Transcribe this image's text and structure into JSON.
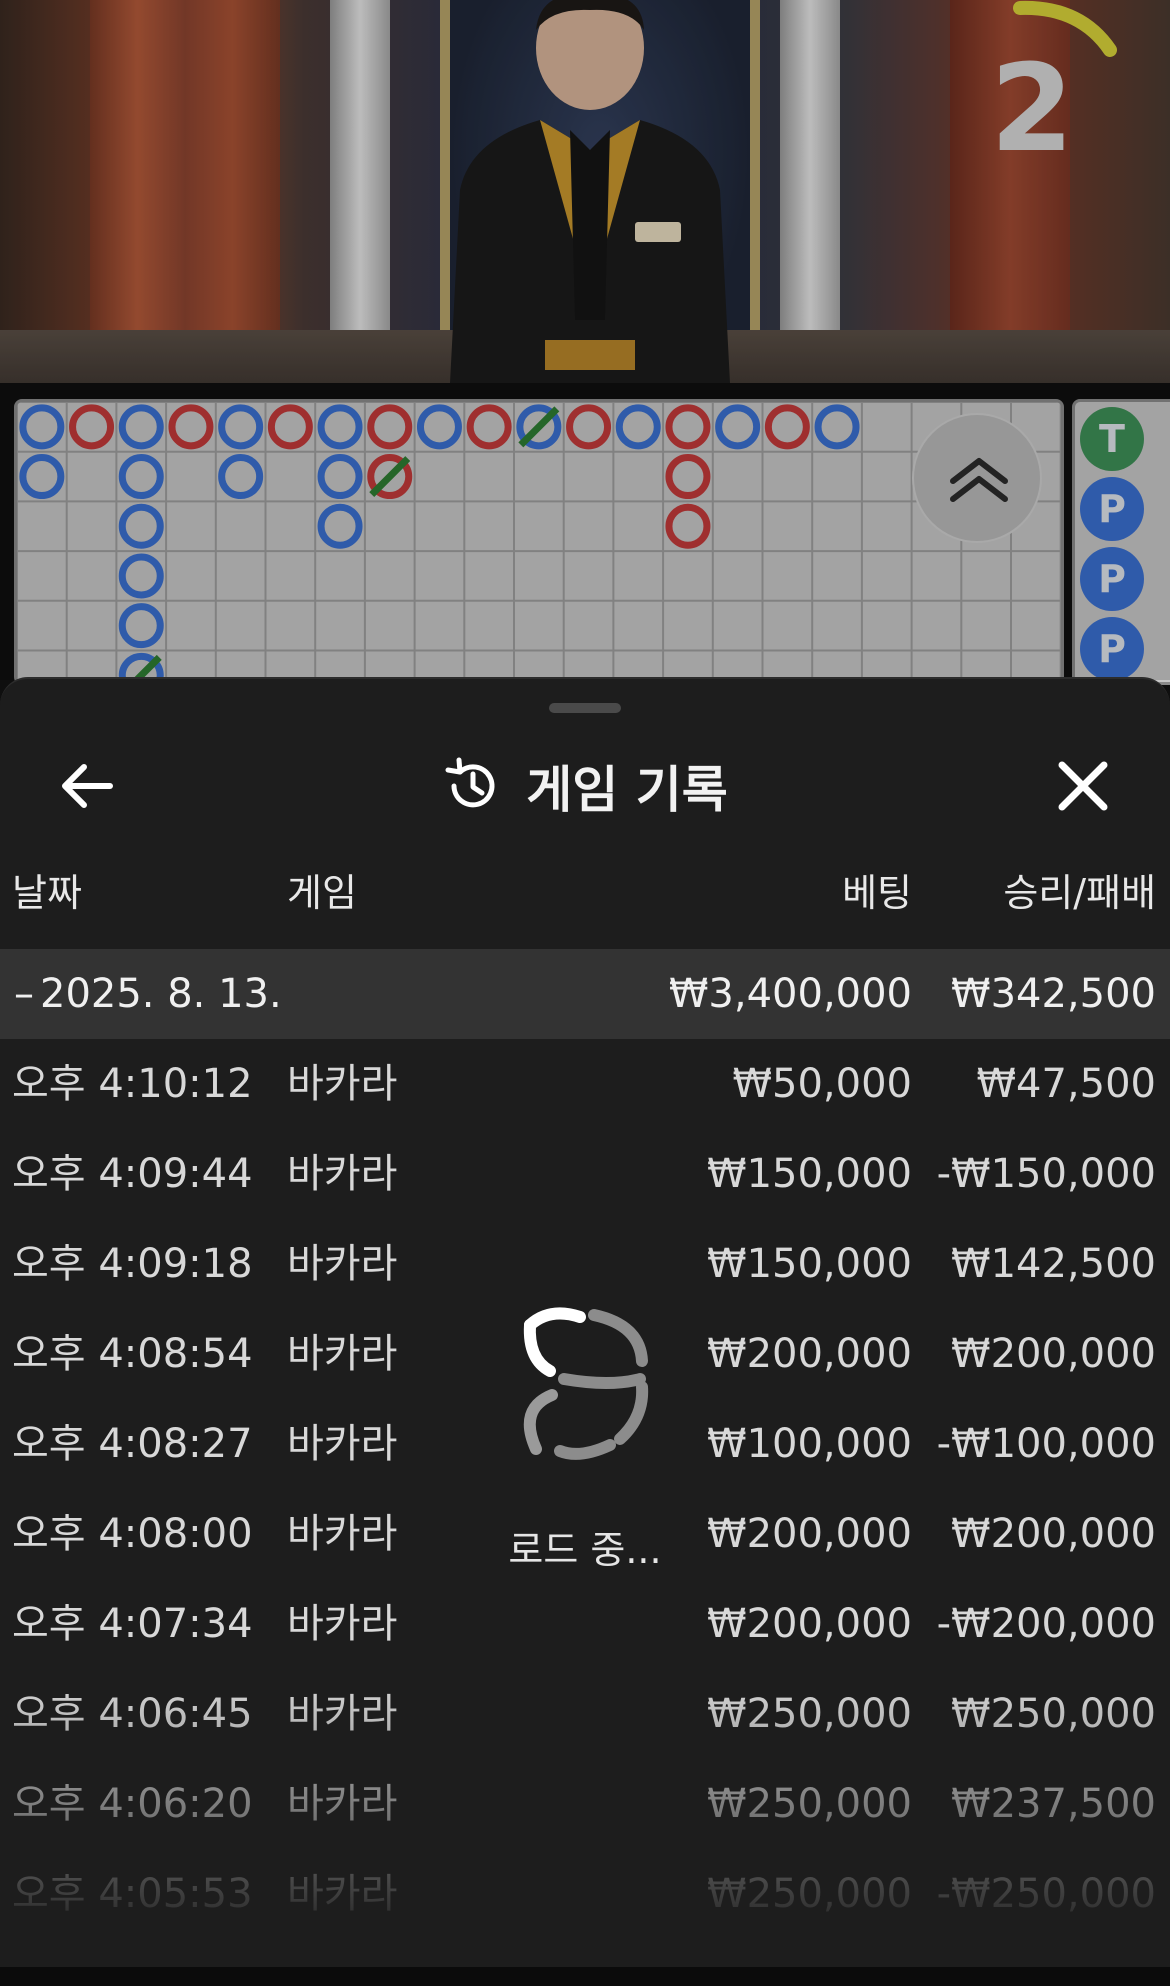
{
  "video": {
    "countdown": "2"
  },
  "sheet": {
    "title": "게임 기록",
    "columns": {
      "date": "날짜",
      "game": "게임",
      "bet": "베팅",
      "win_loss": "승리/패배"
    },
    "date_group": {
      "toggle": "–",
      "date": "2025. 8. 13.",
      "bet_total": "₩3,400,000",
      "win_loss_total": "₩342,500"
    },
    "rows": [
      {
        "time": "오후 4:10:12",
        "game": "바카라",
        "bet": "₩50,000",
        "win_loss": "₩47,500"
      },
      {
        "time": "오후 4:09:44",
        "game": "바카라",
        "bet": "₩150,000",
        "win_loss": "-₩150,000"
      },
      {
        "time": "오후 4:09:18",
        "game": "바카라",
        "bet": "₩150,000",
        "win_loss": "₩142,500"
      },
      {
        "time": "오후 4:08:54",
        "game": "바카라",
        "bet": "₩200,000",
        "win_loss": "₩200,000"
      },
      {
        "time": "오후 4:08:27",
        "game": "바카라",
        "bet": "₩100,000",
        "win_loss": "-₩100,000"
      },
      {
        "time": "오후 4:08:00",
        "game": "바카라",
        "bet": "₩200,000",
        "win_loss": "₩200,000"
      },
      {
        "time": "오후 4:07:34",
        "game": "바카라",
        "bet": "₩200,000",
        "win_loss": "-₩200,000"
      },
      {
        "time": "오후 4:06:45",
        "game": "바카라",
        "bet": "₩250,000",
        "win_loss": "₩250,000"
      },
      {
        "time": "오후 4:06:20",
        "game": "바카라",
        "bet": "₩250,000",
        "win_loss": "₩237,500"
      },
      {
        "time": "오후 4:05:53",
        "game": "바카라",
        "bet": "₩250,000",
        "win_loss": "-₩250,000"
      }
    ],
    "loading_text": "로드 중..."
  },
  "side_road": [
    "T",
    "P",
    "P",
    "P"
  ],
  "colors": {
    "player_blue": "#3a6fd0",
    "banker_red": "#c23a3a",
    "tie_green": "#2e7d32",
    "sheet_bg": "#1d1d1d"
  },
  "icons": [
    "back-arrow-icon",
    "history-icon",
    "close-icon",
    "chevron-double-up-icon",
    "spinner-icon"
  ]
}
